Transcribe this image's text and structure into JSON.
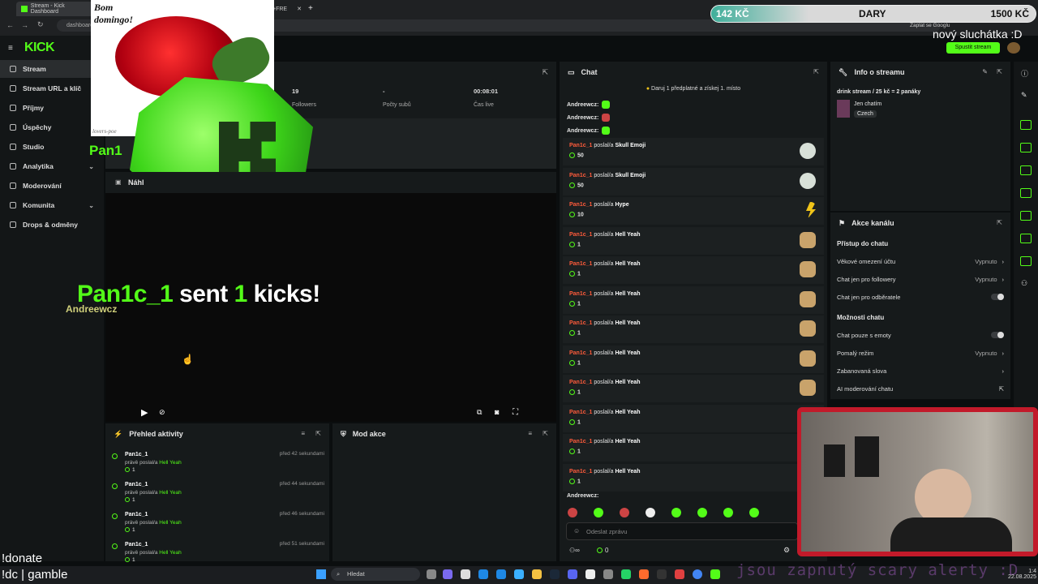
{
  "browser": {
    "tabs": [
      "Stream - Kick Dashboard",
      "+FRE"
    ],
    "address": "dashboard"
  },
  "overlay": {
    "donation_left": "142 KČ",
    "donation_title": "DARY",
    "donation_right": "1500 KČ",
    "new_listener": "nový sluchátka :D",
    "card_text": "Bom domingo!",
    "card_watermark": "lovers-poe",
    "gift_name": "Pan1",
    "alert_user": "Pan1c_1",
    "alert_sent": " sent ",
    "alert_count": "1",
    "alert_kicks": " kicks!",
    "alert_sub": "Andreewcz",
    "bottom_left_1": "!donate",
    "bottom_left_2": "!dc | gamble",
    "scroll_text": "jsou zapnutý scary alerty :D",
    "google_pay": "Zaplat se Googlu",
    "start_stream": "Spustit stream"
  },
  "sidebar": {
    "logo": "KICK",
    "items": [
      {
        "label": "Stream",
        "icon": "stream-icon"
      },
      {
        "label": "Stream URL a klíč",
        "icon": "key-icon"
      },
      {
        "label": "Příjmy",
        "icon": "income-icon"
      },
      {
        "label": "Úspěchy",
        "icon": "trophy-icon"
      },
      {
        "label": "Studio",
        "icon": "studio-icon"
      },
      {
        "label": "Analytika",
        "icon": "analytics-icon"
      },
      {
        "label": "Moderování",
        "icon": "moderation-icon"
      },
      {
        "label": "Komunita",
        "icon": "community-icon"
      },
      {
        "label": "Drops & odměny",
        "icon": "gift-icon"
      }
    ]
  },
  "stats": [
    {
      "value": "19",
      "label": "Followers"
    },
    {
      "value": "-",
      "label": "Počty subů"
    },
    {
      "value": "00:08:01",
      "label": "Čas live"
    }
  ],
  "preview": {
    "title": "Náhl"
  },
  "activity": {
    "title": "Přehled aktivity",
    "items": [
      {
        "name": "Pan1c_1",
        "action": "právě poslal/a",
        "item": "Hell Yeah",
        "count": "1",
        "time": "před 42 sekundami"
      },
      {
        "name": "Pan1c_1",
        "action": "právě poslal/a",
        "item": "Hell Yeah",
        "count": "1",
        "time": "před 44 sekundami"
      },
      {
        "name": "Pan1c_1",
        "action": "právě poslal/a",
        "item": "Hell Yeah",
        "count": "1",
        "time": "před 46 sekundami"
      },
      {
        "name": "Pan1c_1",
        "action": "právě poslal/a",
        "item": "Hell Yeah",
        "count": "1",
        "time": "před 51 sekundami"
      }
    ]
  },
  "mod": {
    "title": "Mod akce"
  },
  "chat": {
    "title": "Chat",
    "banner": "Daruj 1 předplatné a získej 1. místo",
    "plain": [
      "Andreewcz:",
      "Andreewcz:",
      "Andreewcz:"
    ],
    "messages": [
      {
        "user": "Pan1c_1",
        "action": "poslal/a",
        "item": "Skull Emoji",
        "count": "50",
        "emoji": "skull"
      },
      {
        "user": "Pan1c_1",
        "action": "poslal/a",
        "item": "Skull Emoji",
        "count": "50",
        "emoji": "skull"
      },
      {
        "user": "Pan1c_1",
        "action": "poslal/a",
        "item": "Hype",
        "count": "10",
        "emoji": "bolt"
      },
      {
        "user": "Pan1c_1",
        "action": "poslal/a",
        "item": "Hell Yeah",
        "count": "1",
        "emoji": "hand"
      },
      {
        "user": "Pan1c_1",
        "action": "poslal/a",
        "item": "Hell Yeah",
        "count": "1",
        "emoji": "hand"
      },
      {
        "user": "Pan1c_1",
        "action": "poslal/a",
        "item": "Hell Yeah",
        "count": "1",
        "emoji": "hand"
      },
      {
        "user": "Pan1c_1",
        "action": "poslal/a",
        "item": "Hell Yeah",
        "count": "1",
        "emoji": "hand"
      },
      {
        "user": "Pan1c_1",
        "action": "poslal/a",
        "item": "Hell Yeah",
        "count": "1",
        "emoji": "hand"
      },
      {
        "user": "Pan1c_1",
        "action": "poslal/a",
        "item": "Hell Yeah",
        "count": "1",
        "emoji": "hand"
      },
      {
        "user": "Pan1c_1",
        "action": "poslal/a",
        "item": "Hell Yeah",
        "count": "1",
        "emoji": "hand"
      },
      {
        "user": "Pan1c_1",
        "action": "poslal/a",
        "item": "Hell Yeah",
        "count": "1",
        "emoji": "hand"
      },
      {
        "user": "Pan1c_1",
        "action": "poslal/a",
        "item": "Hell Yeah",
        "count": "1",
        "emoji": "hand"
      }
    ],
    "last": "Andreewcz:",
    "placeholder": "Odeslat zprávu",
    "kicks": "0"
  },
  "info": {
    "title": "Info o streamu",
    "stream_title": "drink stream / 25 kč = 2 panáky",
    "category": "Jen chatím",
    "language": "Czech"
  },
  "actions": {
    "title": "Akce kanálu",
    "chat_access": "Přístup do chatu",
    "rows1": [
      {
        "label": "Věkové omezení účtu",
        "value": "Vypnuto",
        "type": "arrow"
      },
      {
        "label": "Chat jen pro followery",
        "value": "Vypnuto",
        "type": "arrow"
      },
      {
        "label": "Chat jen pro odběratele",
        "value": "",
        "type": "toggle"
      }
    ],
    "chat_options": "Možnosti chatu",
    "rows2": [
      {
        "label": "Chat pouze s emoty",
        "value": "",
        "type": "toggle"
      },
      {
        "label": "Pomalý režim",
        "value": "Vypnuto",
        "type": "arrow"
      },
      {
        "label": "Zabanovaná slova",
        "value": "",
        "type": "arrow"
      },
      {
        "label": "AI moderování chatu",
        "value": "",
        "type": "ext"
      }
    ]
  },
  "taskbar": {
    "search": "Hledat",
    "date": "22.08.2025",
    "time": "1:4"
  },
  "colors": {
    "kick_green": "#53fc18",
    "bg": "#0b0e0f",
    "panel": "#161a1b",
    "red": "#ff5b3b"
  }
}
